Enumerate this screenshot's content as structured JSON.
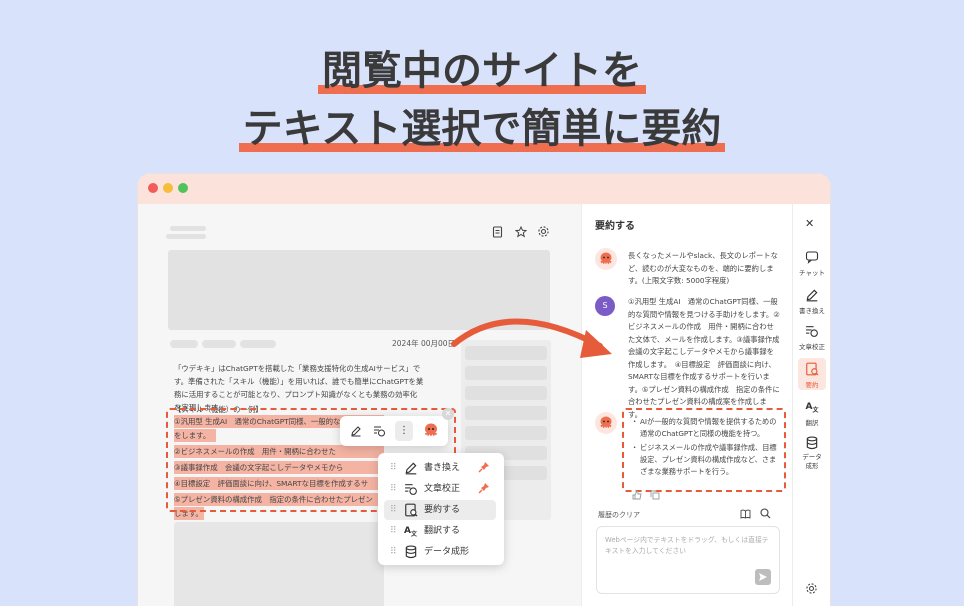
{
  "headline": {
    "line1": "閲覧中のサイトを",
    "line2": "テキスト選択で簡単に要約"
  },
  "colors": {
    "accent": "#ee6e4f",
    "background": "#d9e2fb",
    "titlebar": "#fbe3dc",
    "highlight": "#f4b3a3"
  },
  "article": {
    "date": "2024年 00月00日",
    "intro": "「ウデキキ」はChatGPTを搭載した「業務支援特化の生成AIサービス」です。準備された「スキル（機能）」を用いれば、誰でも簡単にChatGPTを業務に活用することが可能となり、プロンプト知識がなくとも業務の効率化を実現します。",
    "list_header": "【スキル（機能）の一例】",
    "items": [
      "①汎用型 生成AI　通常のChatGPT同様、一般的な",
      "をします。",
      "②ビジネスメールの作成　用件・開柄に合わせた",
      "③議事録作成　会議の文字起こしデータやメモから",
      "④目標設定　評価面談に向け、SMARTな目標を作成するサ",
      "⑤プレゼン資料の構成作成　指定の条件に合わせたプレゼン",
      "します。"
    ]
  },
  "context_menu": {
    "items": [
      {
        "label": "書き換え",
        "icon": "pencil-icon",
        "pinned": true
      },
      {
        "label": "文章校正",
        "icon": "proofread-icon",
        "pinned": true
      },
      {
        "label": "要約する",
        "icon": "summary-icon",
        "pinned": false
      },
      {
        "label": "翻訳する",
        "icon": "translate-icon",
        "pinned": false
      },
      {
        "label": "データ成形",
        "icon": "database-icon",
        "pinned": false
      }
    ]
  },
  "panel": {
    "title": "要約する",
    "bot_message": "長くなったメールやslack、長文のレポートなど、読むのが大変なものを、端的に要約します。(上限文字数: 5000字程度)",
    "user_avatar": "S",
    "user_message": "①汎用型 生成AI　通常のChatGPT同様、一般的な質問や情報を見つける手助けをします。②ビジネスメールの作成　用件・開柄に合わせた文体で、メールを作成します。③議事録作成　会議の文字起こしデータやメモから議事録を作成します。　④目標設定　評価面談に向け、SMARTな目標を作成するサポートを行います。⑤プレゼン資料の構成作成　指定の条件に合わせたプレゼン資料の構成案を作成します。",
    "summary_bullets": [
      "AIが一般的な質問や情報を提供するための通常のChatGPTと同様の機能を持つ。",
      "ビジネスメールの作成や議事録作成、目標設定、プレゼン資料の構成作成など、さまざまな業務サポートを行う。"
    ],
    "history_clear": "履歴のクリア",
    "input_placeholder": "Webページ内でテキストをドラッグ、もしくは直接テキストを入力してください"
  },
  "rail": {
    "items": [
      {
        "label": "チャット",
        "icon": "chat-icon"
      },
      {
        "label": "書き換え",
        "icon": "pencil-icon"
      },
      {
        "label": "文章校正",
        "icon": "proofread-icon"
      },
      {
        "label": "要約",
        "icon": "summary-icon",
        "active": true
      },
      {
        "label": "翻訳",
        "icon": "translate-icon"
      },
      {
        "label": "データ成形",
        "icon": "database-icon"
      }
    ]
  }
}
